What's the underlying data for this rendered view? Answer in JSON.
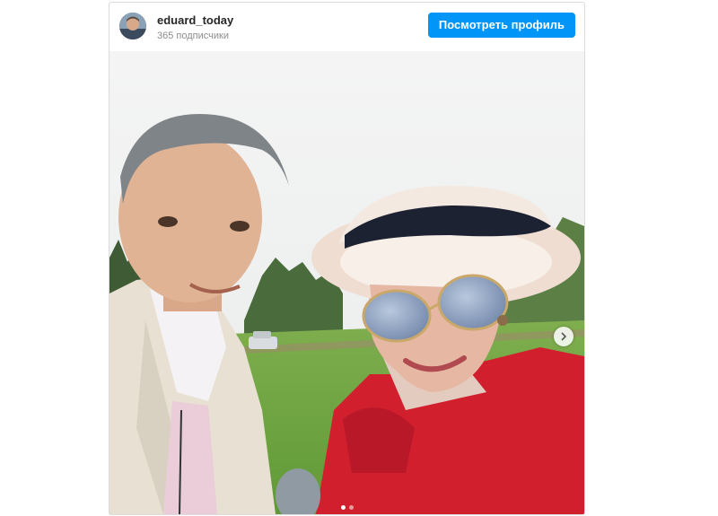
{
  "post": {
    "username": "eduard_today",
    "followers": "365 подписчики",
    "view_profile_label": "Посмотреть профиль"
  },
  "carousel": {
    "total_slides": 2,
    "active_slide": 1
  },
  "icons": {
    "avatar": "profile-avatar",
    "next": "chevron-right-icon"
  },
  "colors": {
    "accent": "#0095f6",
    "username": "#262626",
    "secondary_text": "#8e8e8e"
  }
}
